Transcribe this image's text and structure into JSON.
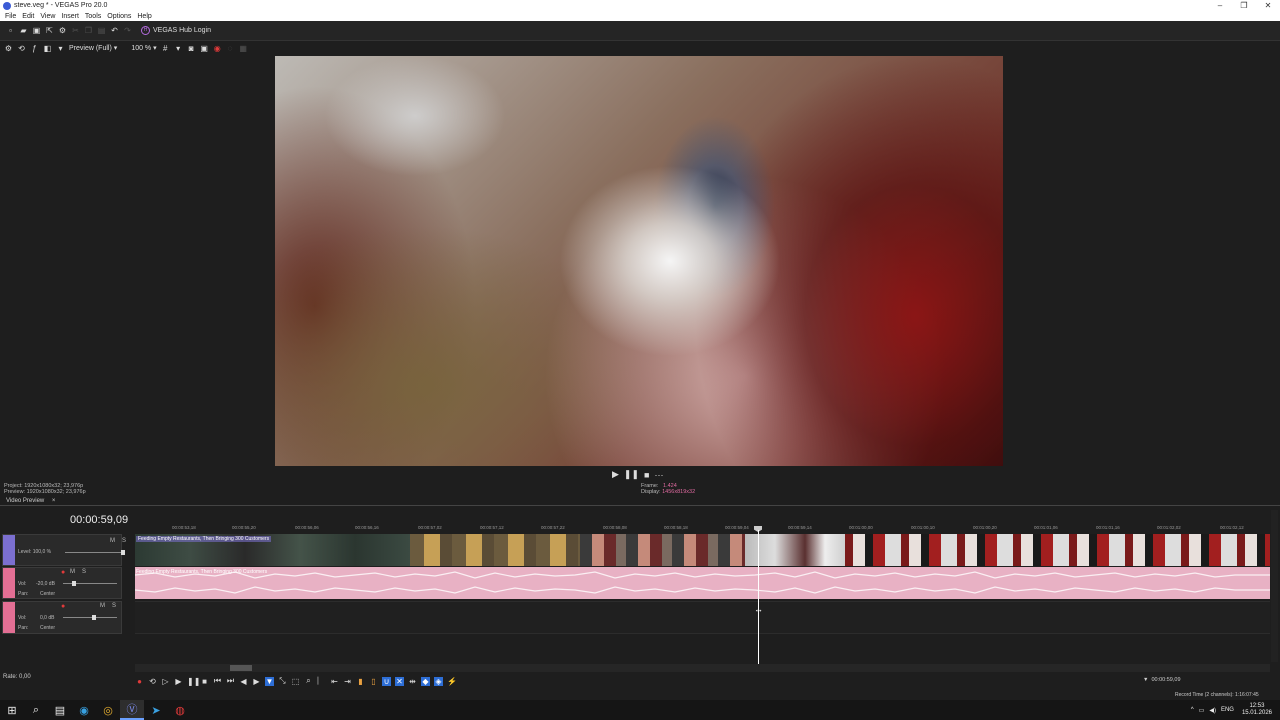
{
  "window": {
    "title": "steve.veg * - VEGAS Pro 20.0"
  },
  "menu": [
    "File",
    "Edit",
    "View",
    "Insert",
    "Tools",
    "Options",
    "Help"
  ],
  "toolbar": {
    "hub_label": "VEGAS Hub Login",
    "hub_icon": "H"
  },
  "preview_bar": {
    "quality": "Preview (Full)",
    "zoom": "100 %"
  },
  "transport": {
    "play": "▶",
    "pause": "❚❚",
    "stop": "■",
    "more": "···"
  },
  "project_info": {
    "project_label": "Project:",
    "project_value": "1920x1080x32; 23,976p",
    "preview_label": "Preview:",
    "preview_value": "1920x1080x32; 23,976p"
  },
  "frame_info": {
    "frame_label": "Frame:",
    "frame_value": "1.424",
    "display_label": "Display:",
    "display_value": "1456x819x32"
  },
  "video_preview_tab": {
    "label": "Video Preview",
    "close": "×"
  },
  "timeline": {
    "timecode": "00:00:59,09",
    "ruler": [
      "00:00:53,18",
      "00:00:55,20",
      "00:00:56,06",
      "00:00:56,16",
      "00:00:57,02",
      "00:00:57,12",
      "00:00:57,22",
      "00:00:58,08",
      "00:00:58,18",
      "00:00:59,04",
      "00:00:59,14",
      "00:01:00,00",
      "00:01:00,10",
      "00:01:00,20",
      "00:01:01,06",
      "00:01:01,16",
      "00:01:02,02",
      "00:01:02,12"
    ],
    "video_track": {
      "level_label": "Level: 100,0 %",
      "m": "M",
      "s": "S",
      "clip_label": "Feeding Empty Restaurants, Then Bringing 300 Customers"
    },
    "audio_track": {
      "vol_label": "Vol:",
      "vol_value": "-20,0 dB",
      "pan_label": "Pan:",
      "pan_value": "Center",
      "m": "M",
      "s": "S",
      "clip_label": "Feeding Empty Restaurants, Then Bringing 300 Customers"
    },
    "audio_track2": {
      "vol_label": "Vol:",
      "vol_value": "0,0 dB",
      "pan_label": "Pan:",
      "pan_value": "Center",
      "m": "M",
      "s": "S"
    }
  },
  "rate": "Rate: 0,00",
  "status": {
    "cursor_time": "00:00:59,09",
    "record_time": "Record Time (2 channels): 1:16:07:45"
  },
  "tray": {
    "lang": "ENG",
    "time": "12:53",
    "date": "15.01.2026"
  },
  "colors": {
    "accent_pink": "#e8b1c4",
    "track_video": "#7b6fd0",
    "track_audio": "#e36f94"
  }
}
